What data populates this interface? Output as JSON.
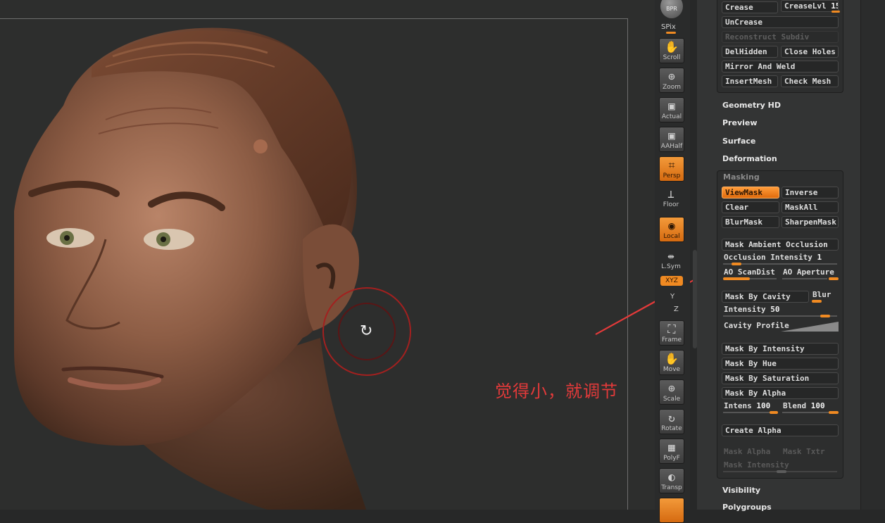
{
  "viewport": {
    "annotation": "觉得小，就调节",
    "rotate_glyph": "↻"
  },
  "shelf": {
    "bpr": "BPR",
    "spix": "SPix",
    "tools": [
      {
        "label": "Scroll",
        "icon": "✋",
        "active": false
      },
      {
        "label": "Zoom",
        "icon": "⊕",
        "active": false
      },
      {
        "label": "Actual",
        "icon": "▣",
        "active": false
      },
      {
        "label": "AAHalf",
        "icon": "▣",
        "active": false
      },
      {
        "label": "Persp",
        "icon": "⌗",
        "active": true
      },
      {
        "label": "Floor",
        "icon": "⊥",
        "active": false
      },
      {
        "label": "Local",
        "icon": "◉",
        "active": true
      },
      {
        "label": "L.Sym",
        "icon": "⇹",
        "active": false
      }
    ],
    "xyz": "XYZ",
    "y_label": "Y",
    "z_label": "Z",
    "lower_tools": [
      {
        "label": "Frame",
        "icon": "⛶"
      },
      {
        "label": "Move",
        "icon": "✋"
      },
      {
        "label": "Scale",
        "icon": "⊕"
      },
      {
        "label": "Rotate",
        "icon": "↻"
      },
      {
        "label": "PolyF",
        "icon": "▦"
      },
      {
        "label": "Transp",
        "icon": "◐"
      }
    ]
  },
  "panel": {
    "top_group": {
      "crease": "Crease",
      "crease_lvl_label": "CreaseLvl",
      "crease_lvl_value": "15",
      "uncrease": "UnCrease",
      "reconstruct": "Reconstruct Subdiv",
      "del_hidden": "DelHidden",
      "close_holes": "Close Holes",
      "mirror_weld": "Mirror And Weld",
      "insert_mesh": "InsertMesh",
      "check_mesh": "Check Mesh"
    },
    "sections": [
      "Geometry HD",
      "Preview",
      "Surface",
      "Deformation"
    ],
    "masking": {
      "title": "Masking",
      "view_mask": "ViewMask",
      "inverse": "Inverse",
      "clear": "Clear",
      "mask_all": "MaskAll",
      "blur_mask": "BlurMask",
      "sharpen_mask": "SharpenMask",
      "mask_ao": "Mask Ambient Occlusion",
      "occlusion_intensity_label": "Occlusion Intensity",
      "occlusion_intensity_value": "1",
      "ao_scandist": "AO ScanDist",
      "ao_aperture": "AO Aperture",
      "mask_by_cavity": "Mask By Cavity",
      "blur": "Blur",
      "intensity_label": "Intensity",
      "intensity_value": "50",
      "cavity_profile": "Cavity Profile",
      "mask_by_intensity": "Mask By Intensity",
      "mask_by_hue": "Mask By Hue",
      "mask_by_saturation": "Mask By Saturation",
      "mask_by_alpha": "Mask By Alpha",
      "intens_label": "Intens",
      "intens_value": "100",
      "blend_label": "Blend",
      "blend_value": "100",
      "create_alpha": "Create Alpha",
      "mask_alpha": "Mask Alpha",
      "mask_txtr": "Mask Txtr",
      "mask_intensity": "Mask Intensity"
    },
    "bottom_sections": [
      "Visibility",
      "Polygroups"
    ]
  },
  "colors": {
    "accent": "#f08a22",
    "annotation": "#e33a3a"
  }
}
